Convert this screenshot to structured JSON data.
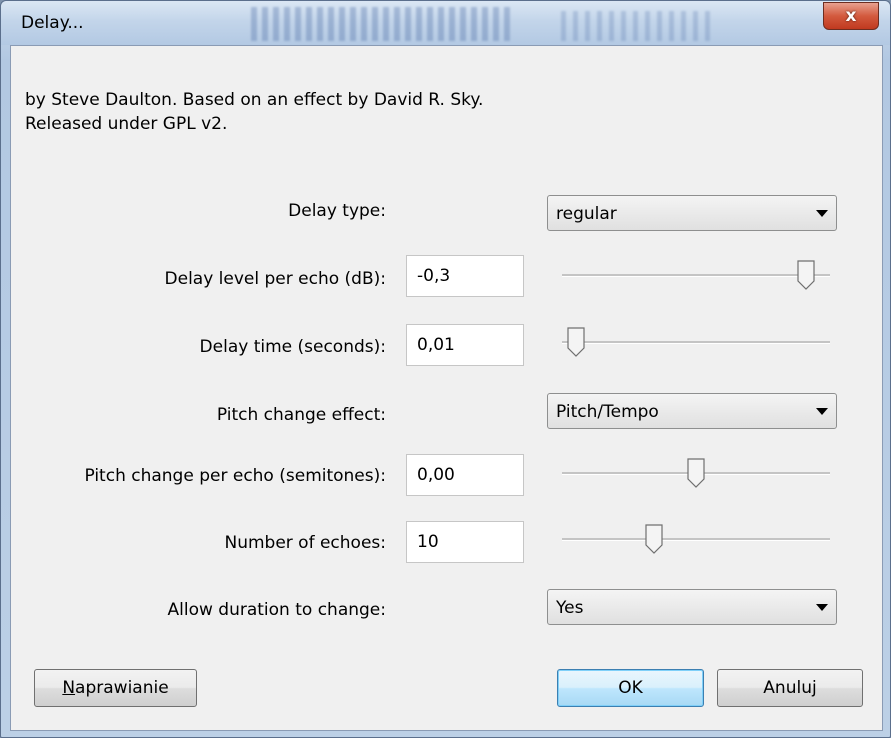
{
  "window": {
    "title": "Delay...",
    "close_label": "x"
  },
  "description": {
    "line1": "by Steve Daulton. Based on an effect by David R. Sky.",
    "line2": "Released under GPL v2."
  },
  "controls": {
    "delay_type": {
      "label": "Delay type:",
      "value": "regular"
    },
    "delay_level": {
      "label": "Delay level per echo (dB):",
      "value": "-0,3",
      "slider_fraction": 0.94
    },
    "delay_time": {
      "label": "Delay time (seconds):",
      "value": "0,01",
      "slider_fraction": 0.02
    },
    "pitch_effect": {
      "label": "Pitch change effect:",
      "value": "Pitch/Tempo"
    },
    "pitch_change": {
      "label": "Pitch change per echo (semitones):",
      "value": "0,00",
      "slider_fraction": 0.5
    },
    "echoes": {
      "label": "Number of echoes:",
      "value": "10",
      "slider_fraction": 0.33
    },
    "allow_duration": {
      "label": "Allow duration to change:",
      "value": "Yes"
    }
  },
  "buttons": {
    "debug": {
      "mnemonic": "N",
      "rest": "aprawianie"
    },
    "ok": "OK",
    "cancel": "Anuluj"
  }
}
